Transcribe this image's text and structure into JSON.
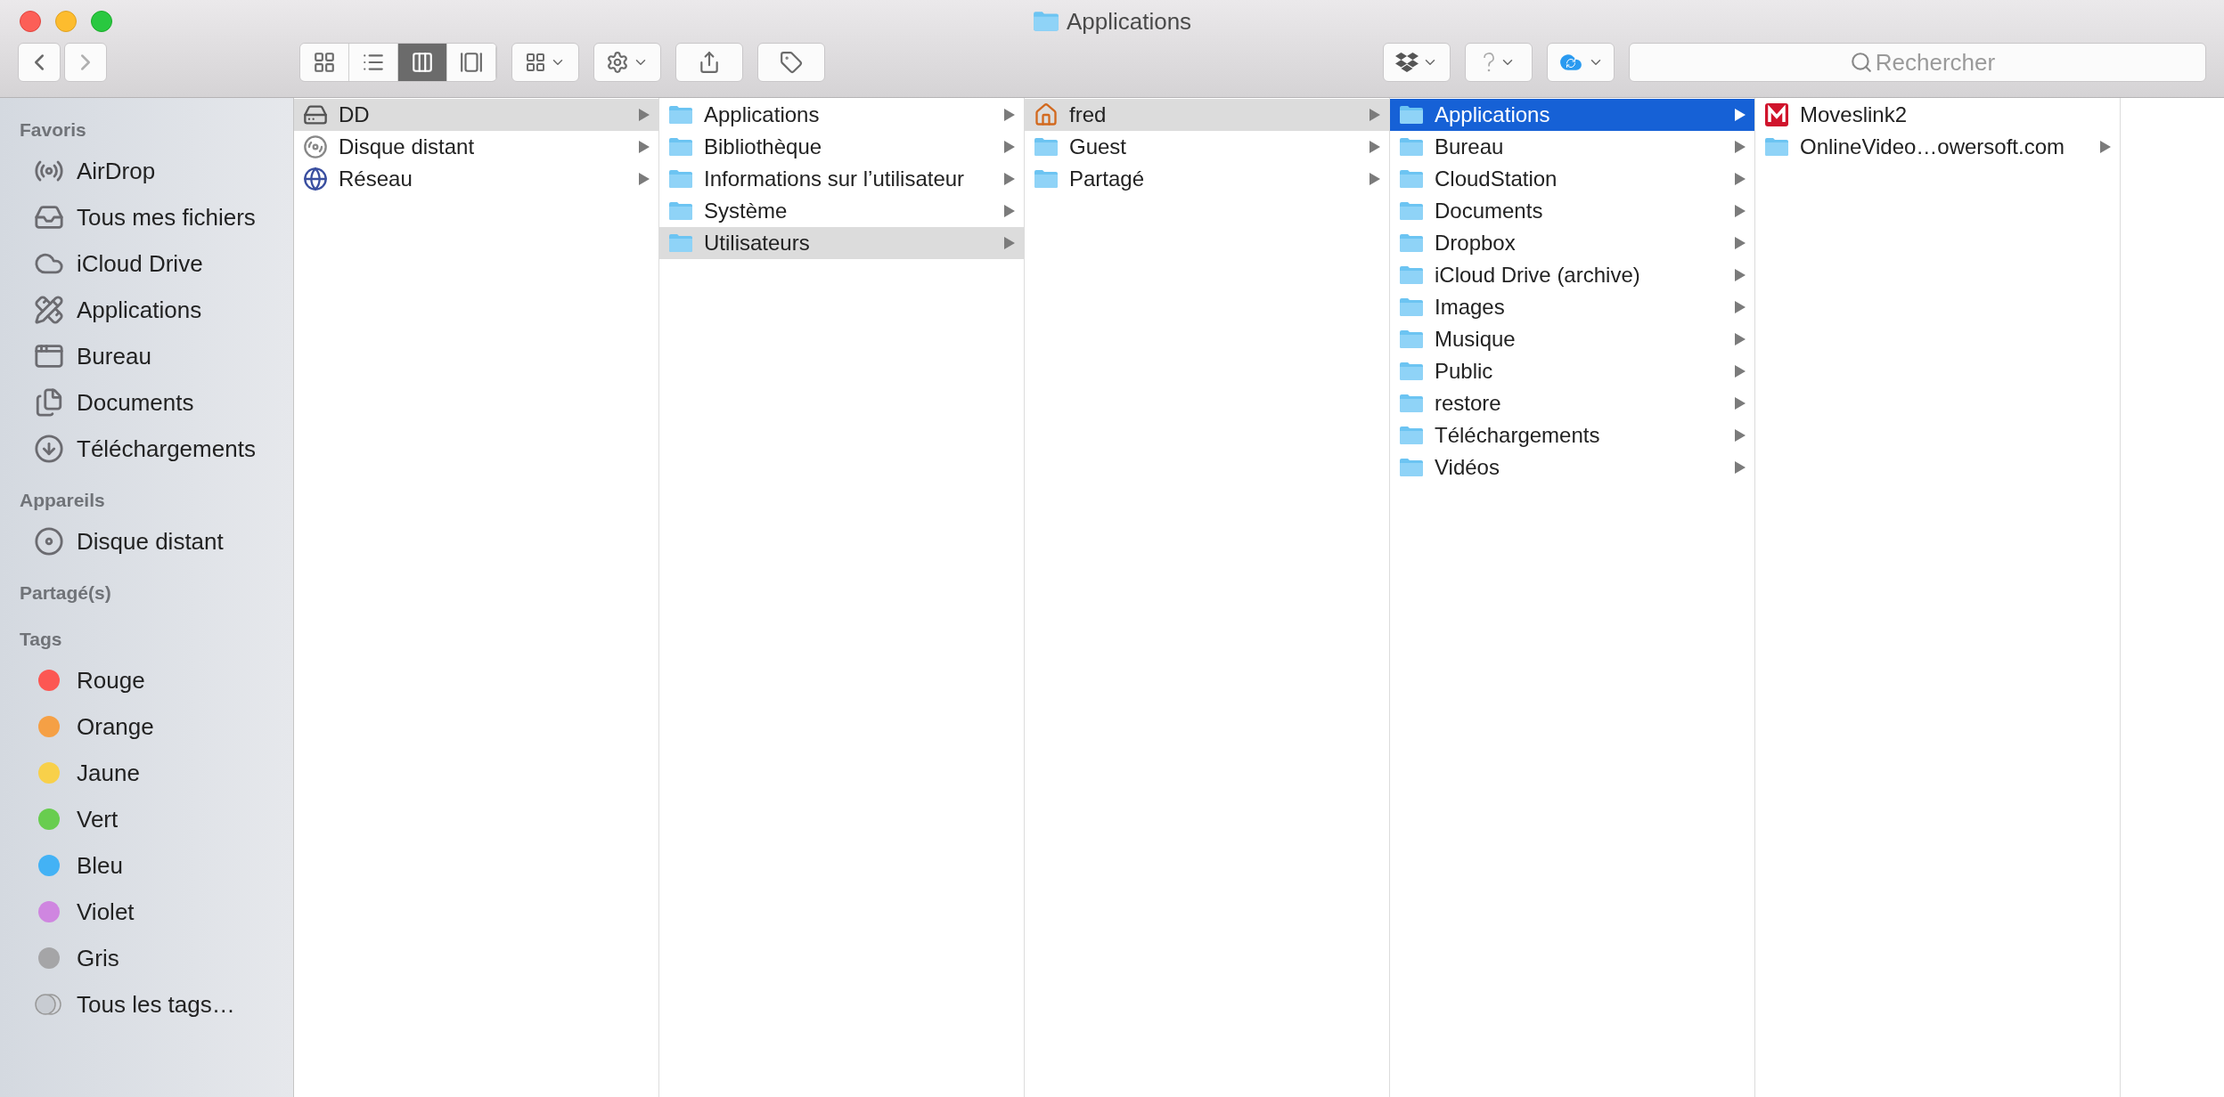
{
  "window": {
    "title": "Applications"
  },
  "toolbar": {
    "views": [
      {
        "kind": "icons",
        "selected": false
      },
      {
        "kind": "list",
        "selected": false
      },
      {
        "kind": "columns",
        "selected": true
      },
      {
        "kind": "gallery",
        "selected": false
      }
    ],
    "search": {
      "placeholder": "Rechercher"
    }
  },
  "sidebar": {
    "sections": [
      {
        "title": "Favoris",
        "items": [
          {
            "label": "AirDrop",
            "kind": "airdrop"
          },
          {
            "label": "Tous mes fichiers",
            "kind": "files"
          },
          {
            "label": "iCloud Drive",
            "kind": "cloud"
          },
          {
            "label": "Applications",
            "kind": "apps"
          },
          {
            "label": "Bureau",
            "kind": "desktop"
          },
          {
            "label": "Documents",
            "kind": "documents"
          },
          {
            "label": "Téléchargements",
            "kind": "downloads"
          }
        ]
      },
      {
        "title": "Appareils",
        "items": [
          {
            "label": "Disque distant",
            "kind": "disc"
          }
        ]
      },
      {
        "title": "Partagé(s)"
      },
      {
        "title": "Tags",
        "items": [
          {
            "label": "Rouge",
            "kind": "tag",
            "color": "#fc5753"
          },
          {
            "label": "Orange",
            "kind": "tag",
            "color": "#f5a045"
          },
          {
            "label": "Jaune",
            "kind": "tag",
            "color": "#f8d04a"
          },
          {
            "label": "Vert",
            "kind": "tag",
            "color": "#68cd4f"
          },
          {
            "label": "Bleu",
            "kind": "tag",
            "color": "#43b2f5"
          },
          {
            "label": "Violet",
            "kind": "tag",
            "color": "#cf86e0"
          },
          {
            "label": "Gris",
            "kind": "tag",
            "color": "#a5a5a7"
          },
          {
            "label": "Tous les tags…",
            "kind": "alltags"
          }
        ]
      }
    ]
  },
  "columns": [
    {
      "active": false,
      "items": [
        {
          "name": "DD",
          "kind": "drive",
          "selected": true,
          "has_children": true
        },
        {
          "name": "Disque distant",
          "kind": "disc",
          "selected": false,
          "has_children": true
        },
        {
          "name": "Réseau",
          "kind": "network",
          "selected": false,
          "has_children": true
        }
      ]
    },
    {
      "active": false,
      "items": [
        {
          "name": "Applications",
          "kind": "folder",
          "selected": false,
          "has_children": true
        },
        {
          "name": "Bibliothèque",
          "kind": "folder",
          "selected": false,
          "has_children": true
        },
        {
          "name": "Informations sur l’utilisateur",
          "kind": "folder",
          "selected": false,
          "has_children": true
        },
        {
          "name": "Système",
          "kind": "folder",
          "selected": false,
          "has_children": true
        },
        {
          "name": "Utilisateurs",
          "kind": "folder",
          "selected": true,
          "has_children": true
        }
      ]
    },
    {
      "active": false,
      "items": [
        {
          "name": "fred",
          "kind": "home",
          "selected": true,
          "has_children": true
        },
        {
          "name": "Guest",
          "kind": "folder",
          "selected": false,
          "has_children": true
        },
        {
          "name": "Partagé",
          "kind": "folder",
          "selected": false,
          "has_children": true
        }
      ]
    },
    {
      "active": true,
      "items": [
        {
          "name": "Applications",
          "kind": "folder",
          "selected": true,
          "has_children": true
        },
        {
          "name": "Bureau",
          "kind": "folder",
          "selected": false,
          "has_children": true
        },
        {
          "name": "CloudStation",
          "kind": "folder",
          "selected": false,
          "has_children": true
        },
        {
          "name": "Documents",
          "kind": "folder",
          "selected": false,
          "has_children": true
        },
        {
          "name": "Dropbox",
          "kind": "folder",
          "selected": false,
          "has_children": true
        },
        {
          "name": "iCloud Drive (archive)",
          "kind": "folder",
          "selected": false,
          "has_children": true
        },
        {
          "name": "Images",
          "kind": "folder",
          "selected": false,
          "has_children": true
        },
        {
          "name": "Musique",
          "kind": "folder",
          "selected": false,
          "has_children": true
        },
        {
          "name": "Public",
          "kind": "folder",
          "selected": false,
          "has_children": true
        },
        {
          "name": "restore",
          "kind": "folder",
          "selected": false,
          "has_children": true
        },
        {
          "name": "Téléchargements",
          "kind": "folder",
          "selected": false,
          "has_children": true
        },
        {
          "name": "Vidéos",
          "kind": "folder",
          "selected": false,
          "has_children": true
        }
      ]
    },
    {
      "items": [
        {
          "name": "Moveslink2",
          "kind": "app",
          "selected": false,
          "has_children": false
        },
        {
          "name": "OnlineVideo…owersoft.com",
          "kind": "folder",
          "selected": false,
          "has_children": true
        }
      ]
    }
  ]
}
